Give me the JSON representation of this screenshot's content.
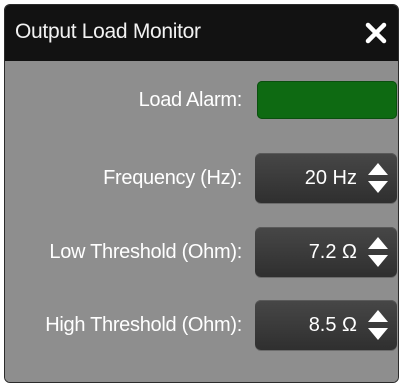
{
  "window": {
    "title": "Output Load Monitor",
    "close_icon": "close-icon"
  },
  "alarm": {
    "label": "Load Alarm:",
    "state_color": "#0e6a12"
  },
  "frequency": {
    "label": "Frequency (Hz):",
    "value": "20 Hz"
  },
  "low_threshold": {
    "label": "Low Threshold (Ohm):",
    "value": "7.2 Ω"
  },
  "high_threshold": {
    "label": "High Threshold (Ohm):",
    "value": "8.5 Ω"
  },
  "icons": {
    "increment": "triangle-up-icon",
    "decrement": "triangle-down-icon"
  },
  "colors": {
    "titlebar": "#121212",
    "panel": "#8e8e8e",
    "control": "#3a3a3a",
    "alarm_ok": "#0e6a12"
  }
}
